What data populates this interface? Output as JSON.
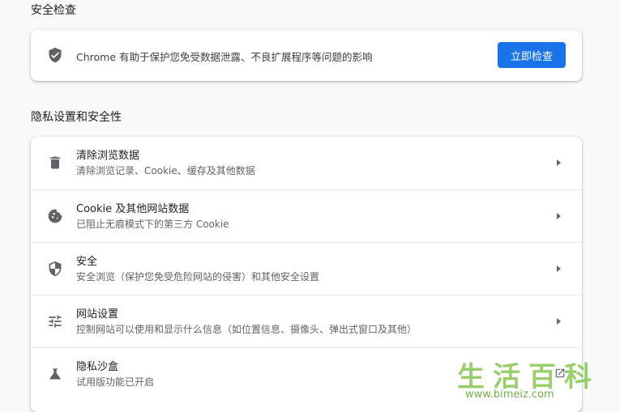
{
  "safety_check": {
    "title": "安全检查",
    "description": "Chrome 有助于保护您免受数据泄露、不良扩展程序等问题的影响",
    "button_label": "立即检查",
    "icon": "shield-check-icon"
  },
  "privacy": {
    "title": "隐私设置和安全性",
    "items": [
      {
        "title": "清除浏览数据",
        "subtitle": "清除浏览记录、Cookie、缓存及其他数据",
        "icon": "trash-icon",
        "action": "arrow"
      },
      {
        "title": "Cookie 及其他网站数据",
        "subtitle": "已阻止无痕模式下的第三方 Cookie",
        "icon": "cookie-icon",
        "action": "arrow"
      },
      {
        "title": "安全",
        "subtitle": "安全浏览（保护您免受危险网站的侵害）和其他安全设置",
        "icon": "shield-icon",
        "action": "arrow"
      },
      {
        "title": "网站设置",
        "subtitle": "控制网站可以使用和显示什么信息（如位置信息、摄像头、弹出式窗口及其他）",
        "icon": "tune-icon",
        "action": "arrow"
      },
      {
        "title": "隐私沙盒",
        "subtitle": "试用版功能已开启",
        "icon": "flask-icon",
        "action": "external"
      }
    ]
  },
  "watermark": {
    "chars": "生活百科",
    "url": "www.bimeiz.com"
  },
  "colors": {
    "accent": "#1a73e8",
    "background": "#f8f9fa",
    "icon": "#5f6368"
  }
}
